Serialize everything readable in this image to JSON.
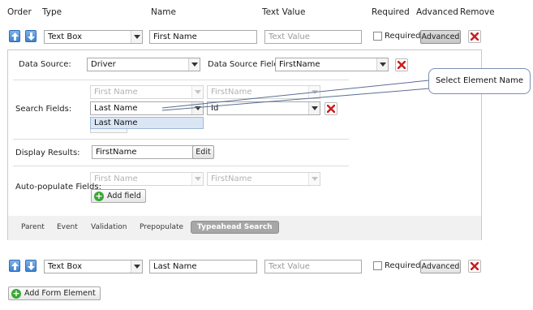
{
  "header": {
    "order": "Order",
    "type": "Type",
    "name": "Name",
    "text_value": "Text Value",
    "required": "Required",
    "advanced": "Advanced",
    "remove": "Remove"
  },
  "rows": [
    {
      "type_value": "Text Box",
      "name_value": "First Name",
      "text_value_placeholder": "Text Value",
      "required_label": "Required",
      "required_checked": false,
      "advanced_label": "Advanced",
      "advanced_active": true
    },
    {
      "type_value": "Text Box",
      "name_value": "Last Name",
      "text_value_placeholder": "Text Value",
      "required_label": "Required",
      "required_checked": false,
      "advanced_label": "Advanced",
      "advanced_active": false
    }
  ],
  "advanced_panel": {
    "data_source_label": "Data Source:",
    "data_source_value": "Driver",
    "data_source_field_label": "Data Source Field:",
    "data_source_field_value": "FirstName",
    "search_fields_label": "Search Fields:",
    "search_rows": [
      {
        "field": "First Name",
        "source": "FirstName",
        "disabled": true
      },
      {
        "field": "Last Name",
        "source": "Id",
        "disabled": false
      }
    ],
    "dropdown_option": "Last Name",
    "display_results_label": "Display Results:",
    "display_results_value": "FirstName",
    "edit_label": "Edit",
    "autopopulate_label": "Auto-populate Fields:",
    "autopopulate_row": {
      "field": "First Name",
      "source": "FirstName",
      "disabled": true
    },
    "add_field_label": "Add field",
    "tabs": [
      "Parent",
      "Event",
      "Validation",
      "Prepopulate",
      "Typeahead Search"
    ],
    "active_tab": "Typeahead Search"
  },
  "callout": {
    "text": "Select Element Name"
  },
  "footer": {
    "add_form_element_label": "Add Form Element"
  },
  "colors": {
    "arrow_blue": "#3f82cf",
    "remove_red": "#cc1f1f",
    "add_green": "#3aa635",
    "dropdown_highlight": "#dbe6f5"
  },
  "icons": {
    "order_up": "arrow-up-icon",
    "order_down": "arrow-down-icon",
    "remove": "close-x-icon",
    "add": "plus-circle-icon"
  }
}
